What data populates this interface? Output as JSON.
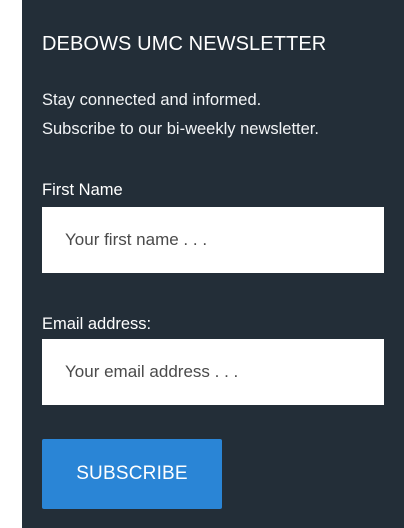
{
  "newsletter": {
    "title": "DEBOWS UMC NEWSLETTER",
    "description_line1": "Stay connected and informed.",
    "description_line2": "Subscribe to our bi-weekly newsletter.",
    "first_name": {
      "label": "First Name",
      "placeholder": "Your first name . . .",
      "value": ""
    },
    "email": {
      "label": "Email address:",
      "placeholder": "Your email address . . .",
      "value": ""
    },
    "subscribe_label": "SUBSCRIBE"
  },
  "colors": {
    "panel_background": "#232e38",
    "button_background": "#2a85d6",
    "text": "#ffffff",
    "field_background": "#ffffff"
  }
}
